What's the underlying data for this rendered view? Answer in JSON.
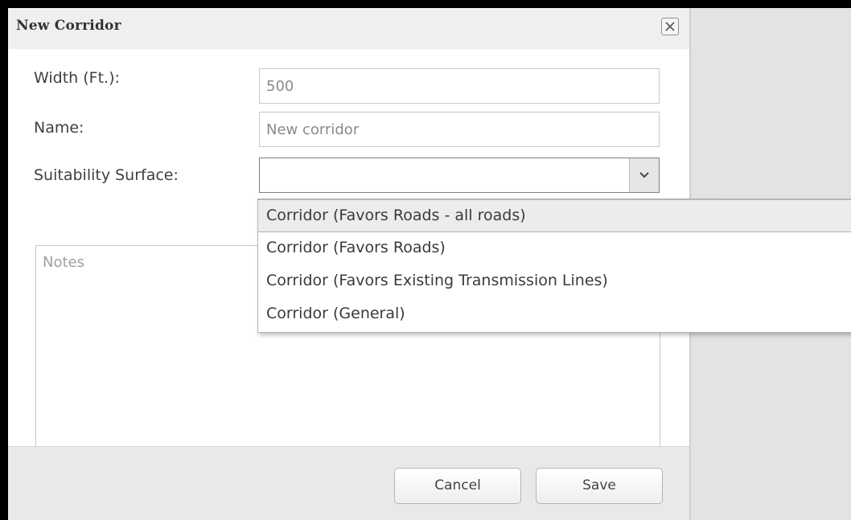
{
  "dialog": {
    "title": "New Corridor",
    "close_icon": "close-x-icon"
  },
  "form": {
    "width_label": "Width (Ft.):",
    "width_value": "500",
    "name_label": "Name:",
    "name_value": "New corridor",
    "suitability_label": "Suitability Surface:",
    "suitability_value": "",
    "notes_placeholder": "Notes"
  },
  "dropdown": {
    "arrow_icon": "chevron-down-icon",
    "options": [
      "Corridor (Favors Roads - all roads)",
      "Corridor (Favors Roads)",
      "Corridor (Favors Existing Transmission Lines)",
      "Corridor (General)"
    ],
    "highlighted_index": 0
  },
  "footer": {
    "cancel_label": "Cancel",
    "save_label": "Save"
  },
  "colors": {
    "frame": "#000000",
    "backdrop": "#e3e3e3",
    "titlebar": "#efefef",
    "footer": "#e9e9e9",
    "highlight": "#ececec"
  }
}
